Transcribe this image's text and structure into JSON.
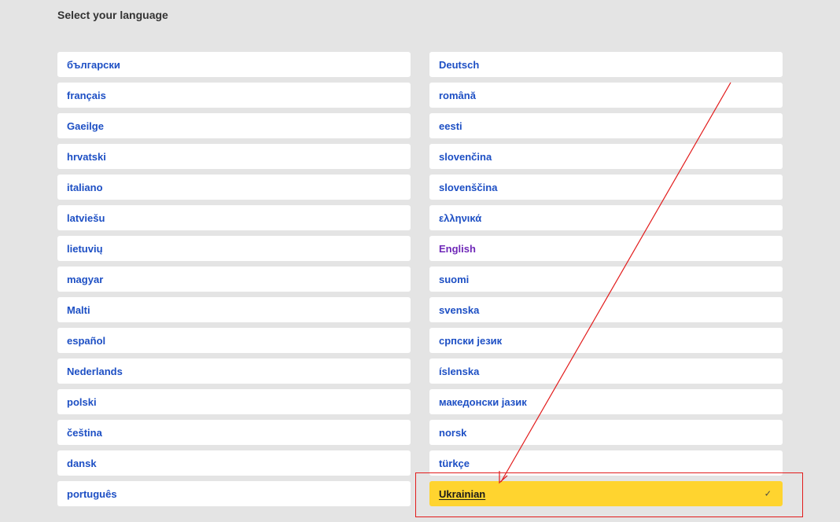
{
  "header": {
    "title": "Select your language"
  },
  "languages": {
    "left": [
      "български",
      "français",
      "Gaeilge",
      "hrvatski",
      "italiano",
      "latviešu",
      "lietuvių",
      "magyar",
      "Malti",
      "español",
      "Nederlands",
      "polski",
      "čeština",
      "dansk",
      "português"
    ],
    "right": [
      "Deutsch",
      "română",
      "eesti",
      "slovenčina",
      "slovenščina",
      "ελληνικά",
      "English",
      "suomi",
      "svenska",
      "српски језик",
      "íslenska",
      "македонски јазик",
      "norsk",
      "türkçe",
      "Ukrainian"
    ]
  },
  "selected_language": "Ukrainian",
  "visited_language": "English",
  "icons": {
    "selected_marker": "check-icon"
  },
  "colors": {
    "link": "#1d4fc4",
    "visited_link": "#6f28b8",
    "selected_bg": "#ffd42f",
    "annotation": "#e21b1b"
  }
}
